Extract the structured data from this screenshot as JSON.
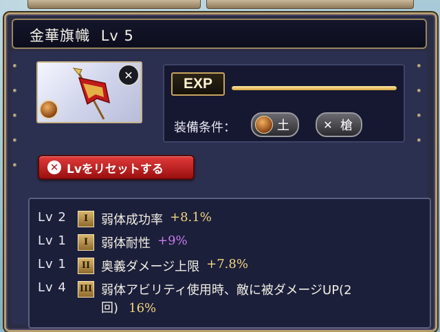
{
  "item": {
    "name": "金華旗幟",
    "level_text": "Lv 5"
  },
  "exp": {
    "label": "EXP",
    "progress": 1.0
  },
  "requirements": {
    "label": "装備条件：",
    "element": "土",
    "weapon": "槍"
  },
  "reset_button": {
    "label": "Lvをリセットする"
  },
  "skills": [
    {
      "level": "Lv 2",
      "rank": "I",
      "name": "弱体成功率",
      "value": "+8.1%",
      "value_color": "#f2d680"
    },
    {
      "level": "Lv 1",
      "rank": "I",
      "name": "弱体耐性",
      "value": "+9%",
      "value_color": "#c97cf0"
    },
    {
      "level": "Lv 1",
      "rank": "II",
      "name": "奥義ダメージ上限",
      "value": "+7.8%",
      "value_color": "#f2d680"
    },
    {
      "level": "Lv 4",
      "rank": "III",
      "name": "弱体アビリティ使用時、敵に被ダメージUP(2",
      "name_cont": "回)",
      "value": "16%",
      "value_color": "#f2d680"
    }
  ],
  "colors": {
    "accent_gold": "#c9a660",
    "reset_red": "#c42222",
    "panel_bg": "#2a2d45"
  },
  "icons": {
    "element_badge": "earth-element-icon",
    "weapon_badge": "spear-weapon-icon",
    "reset": "close-circle-icon"
  }
}
